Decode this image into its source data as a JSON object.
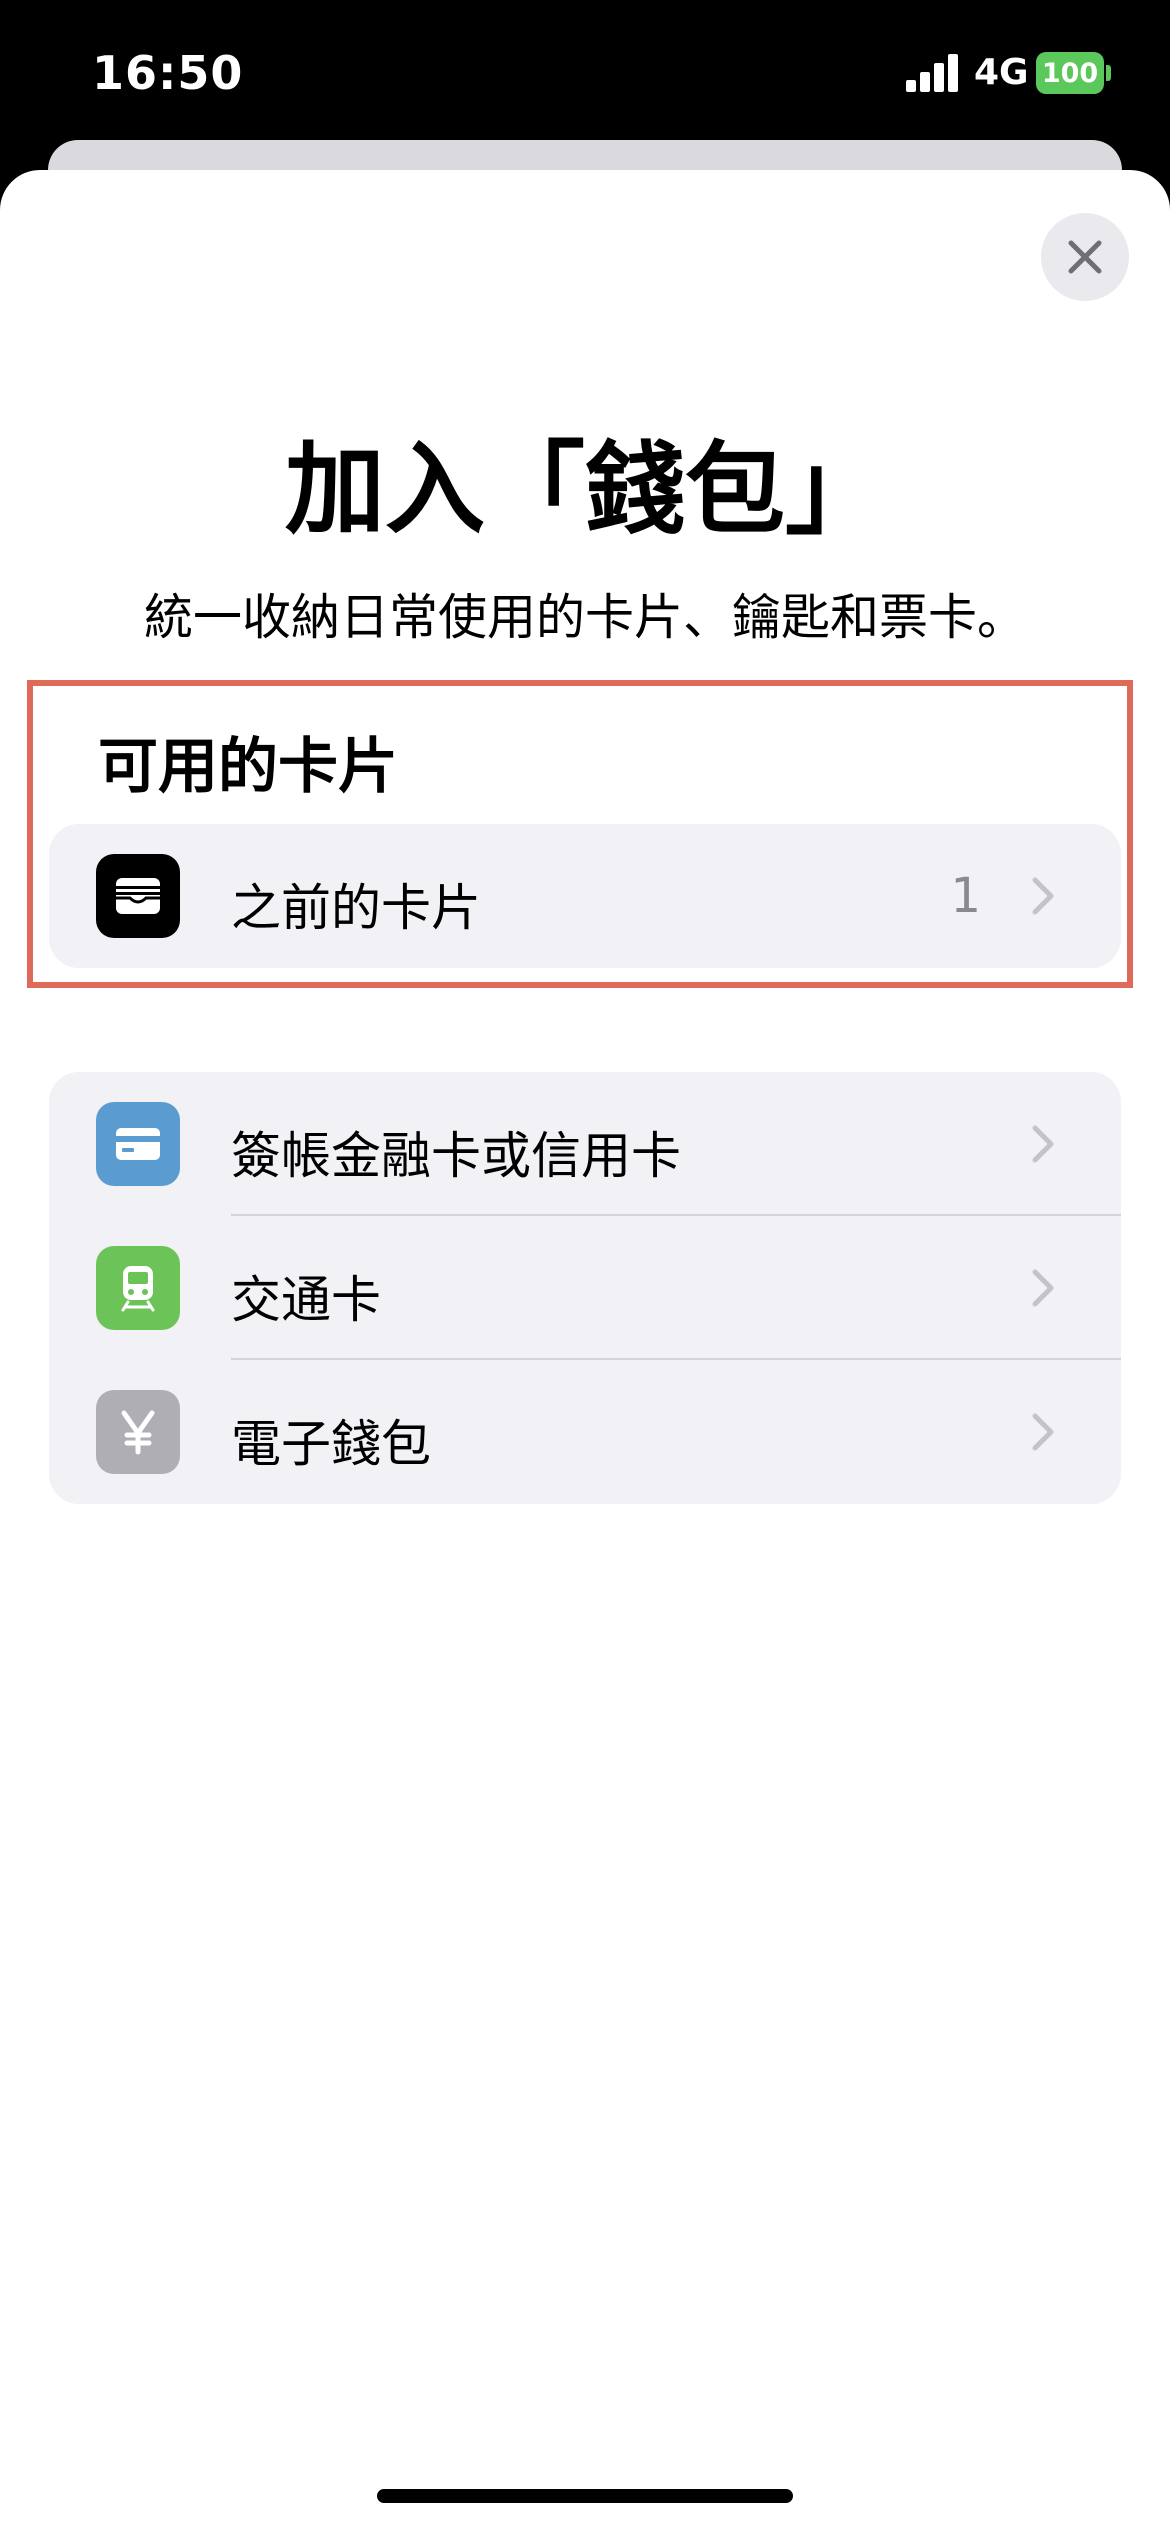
{
  "status_bar": {
    "time": "16:50",
    "network": "4G",
    "battery": "100"
  },
  "header": {
    "title": "加入「錢包」",
    "subtitle": "統一收納日常使用的卡片、鑰匙和票卡。"
  },
  "available_section": {
    "heading": "可用的卡片",
    "items": [
      {
        "label": "之前的卡片",
        "count": "1",
        "icon": "wallet-icon",
        "icon_color": "#000000"
      }
    ]
  },
  "add_section": {
    "items": [
      {
        "label": "簽帳金融卡或信用卡",
        "icon": "credit-card-icon",
        "icon_color": "#5a9ccf"
      },
      {
        "label": "交通卡",
        "icon": "train-icon",
        "icon_color": "#6cc458"
      },
      {
        "label": "電子錢包",
        "icon": "yen-icon",
        "icon_color": "#aeaeb4"
      }
    ]
  },
  "colors": {
    "highlight_border": "#e06a5a",
    "group_background": "#f1f1f6",
    "chevron": "#c4c4c8"
  }
}
